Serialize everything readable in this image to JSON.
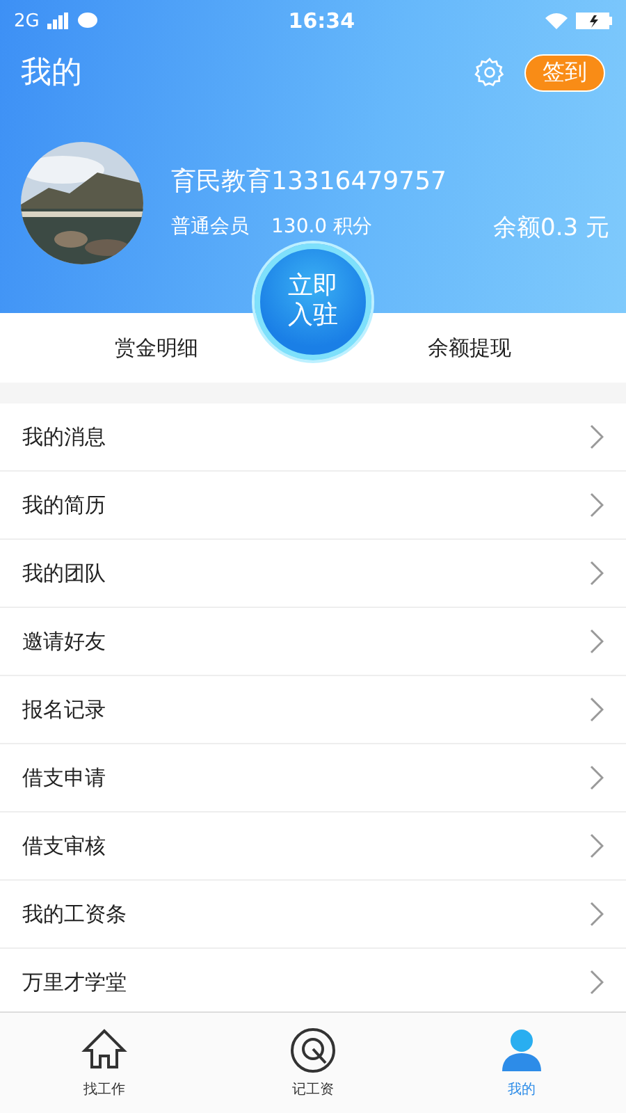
{
  "status_bar": {
    "network": "2G",
    "time": "16:34"
  },
  "header": {
    "title": "我的",
    "checkin_button": "签到"
  },
  "profile": {
    "name": "育民教育13316479757",
    "membership": "普通会员",
    "points": "130.0 积分",
    "balance": "余额0.3 元"
  },
  "actions": {
    "left": "赏金明细",
    "center": "立即入驻",
    "right": "余额提现"
  },
  "menu": [
    {
      "label": "我的消息"
    },
    {
      "label": "我的简历"
    },
    {
      "label": "我的团队"
    },
    {
      "label": "邀请好友"
    },
    {
      "label": "报名记录"
    },
    {
      "label": "借支申请"
    },
    {
      "label": "借支审核"
    },
    {
      "label": "我的工资条"
    },
    {
      "label": "万里才学堂"
    }
  ],
  "tabs": [
    {
      "label": "找工作",
      "kind": "home",
      "selected": false
    },
    {
      "label": "记工资",
      "kind": "record",
      "selected": false
    },
    {
      "label": "我的",
      "kind": "person",
      "selected": true
    }
  ]
}
